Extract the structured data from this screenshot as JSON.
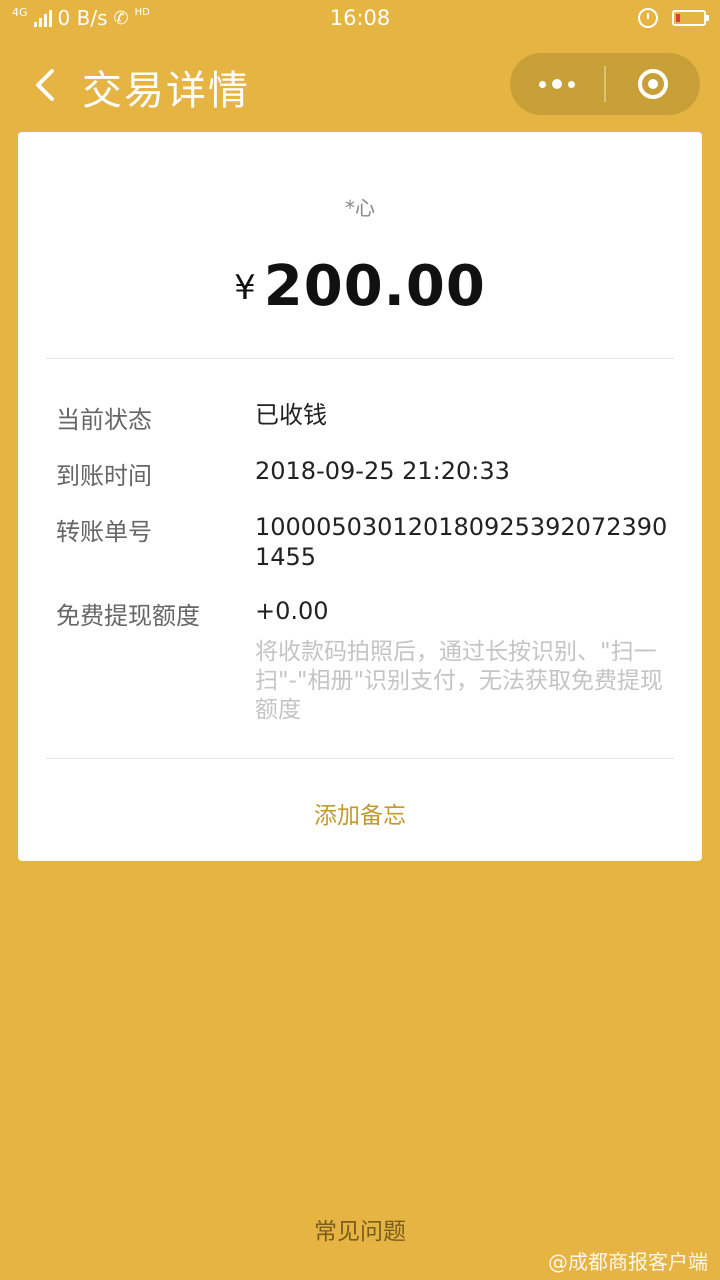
{
  "status_bar": {
    "network": "4G",
    "speed": "0 B/s",
    "hd": "HD",
    "time": "16:08",
    "battery_level": 0.15
  },
  "nav": {
    "title": "交易详情",
    "back_icon": "chevron-left-icon",
    "more_icon": "more-dots-icon",
    "close_icon": "target-icon"
  },
  "card": {
    "payer": "*心",
    "currency": "¥",
    "amount": "200.00",
    "rows": [
      {
        "label": "当前状态",
        "value": "已收钱"
      },
      {
        "label": "到账时间",
        "value": "2018-09-25 21:20:33"
      },
      {
        "label": "转账单号",
        "value": "1000050301201809253920723901455"
      },
      {
        "label": "免费提现额度",
        "value": "+0.00",
        "note": "将收款码拍照后，通过长按识别、\"扫一扫\"-\"相册\"识别支付，无法获取免费提现额度"
      }
    ],
    "memo_label": "添加备忘"
  },
  "faq_label": "常见问题",
  "watermark": "@成都商报客户端",
  "colors": {
    "background": "#E5B443",
    "accent": "#C39A30"
  }
}
